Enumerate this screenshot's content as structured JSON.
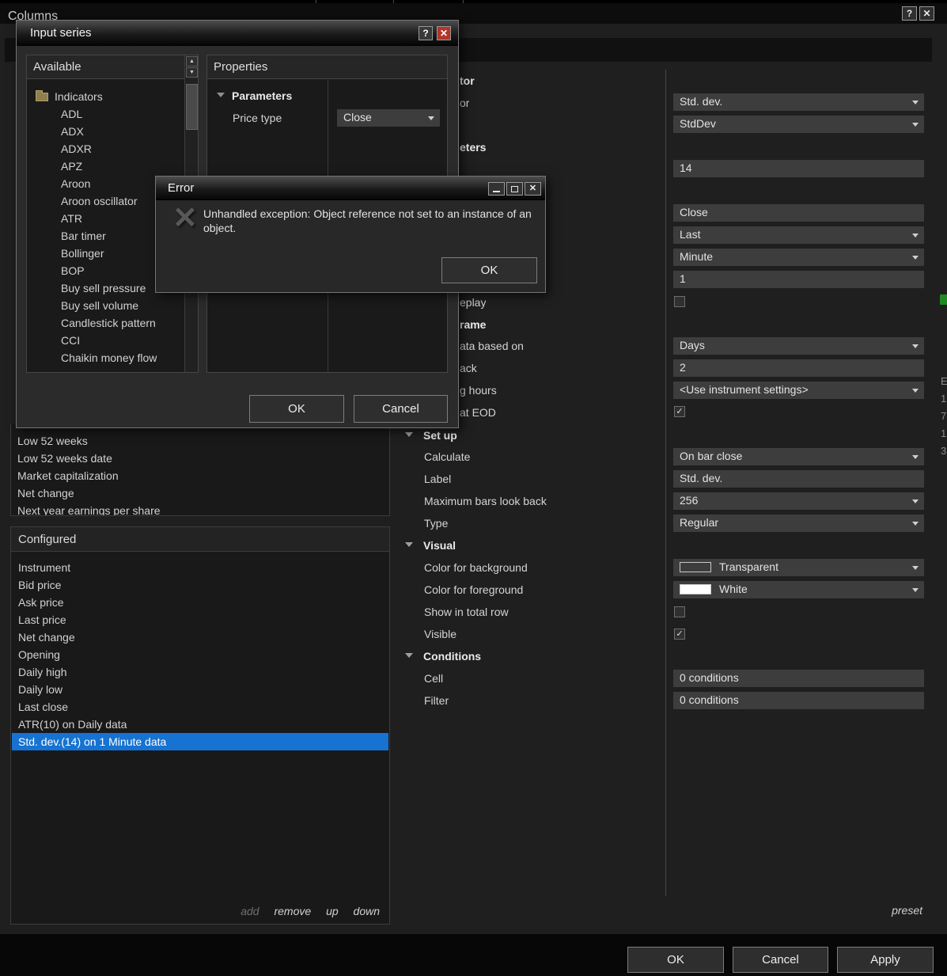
{
  "window": {
    "title": "Columns",
    "help_glyph": "?",
    "close_glyph": "✕"
  },
  "background_list": {
    "items": [
      "Low 52 weeks",
      "Low 52 weeks date",
      "Market capitalization",
      "Net change",
      "Next year earnings per share"
    ]
  },
  "configured": {
    "header": "Configured",
    "items": [
      "Instrument",
      "Bid price",
      "Ask price",
      "Last price",
      "Net change",
      "Opening",
      "Daily high",
      "Daily low",
      "Last close",
      "ATR(10) on Daily data",
      "Std. dev.(14) on 1 Minute data"
    ],
    "selected_item": "Std. dev.(14) on 1 Minute data",
    "actions": {
      "add": "add",
      "remove": "remove",
      "up": "up",
      "down": "down"
    }
  },
  "properties": {
    "fragments": {
      "indicator_heading": "tor",
      "indicator_row": "or",
      "parameters_heading": "eters",
      "replay_row": "eplay",
      "timeframe_heading": "rame",
      "data_based_on_row": "ata based on",
      "days_back_row": "ack",
      "trading_hours_row": "g hours",
      "break_eod_row": "at EOD"
    },
    "labels": {
      "set_up": "Set up",
      "calculate": "Calculate",
      "label": "Label",
      "max_bars": "Maximum bars look back",
      "type": "Type",
      "visual": "Visual",
      "color_background": "Color for background",
      "color_foreground": "Color for foreground",
      "show_in_total_row": "Show in total row",
      "visible": "Visible",
      "conditions": "Conditions",
      "cell": "Cell",
      "filter": "Filter"
    },
    "values": {
      "indicator": "Std. dev.",
      "script": "StdDev",
      "period": "14",
      "price": "Close",
      "bar_value": "Last",
      "bar_type": "Minute",
      "bar_size": "1",
      "data_based_on": "Days",
      "days_back": "2",
      "trading_hours": "<Use instrument settings>",
      "calculate": "On bar close",
      "label": "Std. dev.",
      "max_bars": "256",
      "type": "Regular",
      "color_background": "Transparent",
      "color_foreground": "White",
      "cell": "0 conditions",
      "filter": "0 conditions"
    },
    "checks": {
      "replay": "",
      "break_at_eod": "✓",
      "show_in_total_row": "",
      "visible": "✓"
    },
    "preset_label": "preset"
  },
  "input_series_dialog": {
    "title": "Input series",
    "help_glyph": "?",
    "close_glyph": "✕",
    "available_header": "Available",
    "properties_header": "Properties",
    "tree": {
      "folder": "Indicators",
      "items": [
        "ADL",
        "ADX",
        "ADXR",
        "APZ",
        "Aroon",
        "Aroon oscillator",
        "ATR",
        "Bar timer",
        "Bollinger",
        "BOP",
        "Buy sell pressure",
        "Buy sell volume",
        "Candlestick pattern",
        "CCI",
        "Chaikin money flow"
      ]
    },
    "parameters_heading": "Parameters",
    "price_type_label": "Price type",
    "price_type_value": "Close",
    "ok_label": "OK",
    "cancel_label": "Cancel"
  },
  "error_dialog": {
    "title": "Error",
    "message": "Unhandled exception: Object reference not set to an instance of an object.",
    "ok_label": "OK",
    "close_glyph": "✕"
  },
  "footer": {
    "ok": "OK",
    "cancel": "Cancel",
    "apply": "Apply"
  },
  "icons": {
    "spinner_up": "▲",
    "spinner_down": "▼"
  },
  "colors": {
    "selection": "#1673d2",
    "close_button_red": "#b5342a",
    "foreground_swatch": "#ffffff"
  },
  "edge": {
    "fragments": [
      "E",
      "1",
      "7",
      "1",
      "3"
    ]
  }
}
